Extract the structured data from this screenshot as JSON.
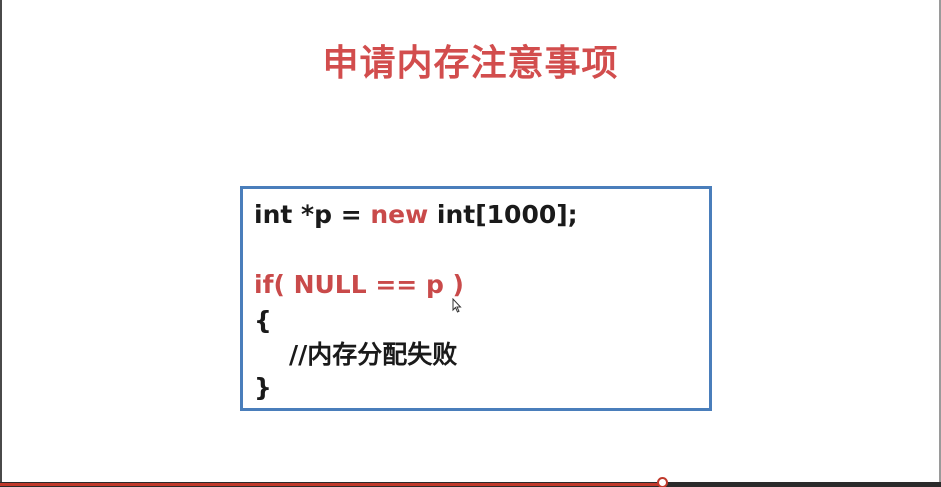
{
  "slide": {
    "title": "申请内存注意事项",
    "code": {
      "line1": {
        "t1": "int *p = ",
        "t2": "new",
        "t3": " int[1000];"
      },
      "line2": "if( NULL == p )",
      "line3": "{",
      "line4": "//内存分配失败",
      "line5": "}"
    }
  },
  "player": {
    "progress_percent": 70.4
  },
  "colors": {
    "title_red": "#d24d4d",
    "keyword_red": "#c94a4a",
    "code_text": "#1a1a1a",
    "box_border": "#4a7ebb",
    "progress_red": "#c0392b"
  }
}
